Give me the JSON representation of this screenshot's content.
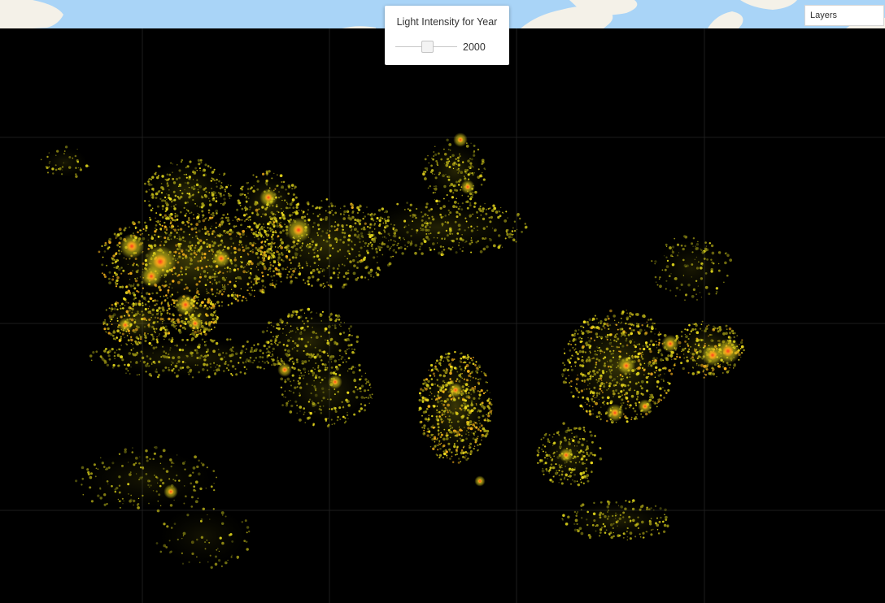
{
  "map": {
    "basemap_colors": {
      "ocean": "#a9d4f7",
      "land": "#f4f1e8",
      "night": "#000000"
    },
    "light_colors": {
      "dim": "#6b6b10",
      "mid": "#d8cf1a",
      "bright": "#f7b21b",
      "core": "#e03a1a"
    },
    "grid_color": "#2a2a2a"
  },
  "year_control": {
    "title": "Light Intensity for Year",
    "selected_year": "2000"
  },
  "layers_control": {
    "label": "Layers"
  }
}
